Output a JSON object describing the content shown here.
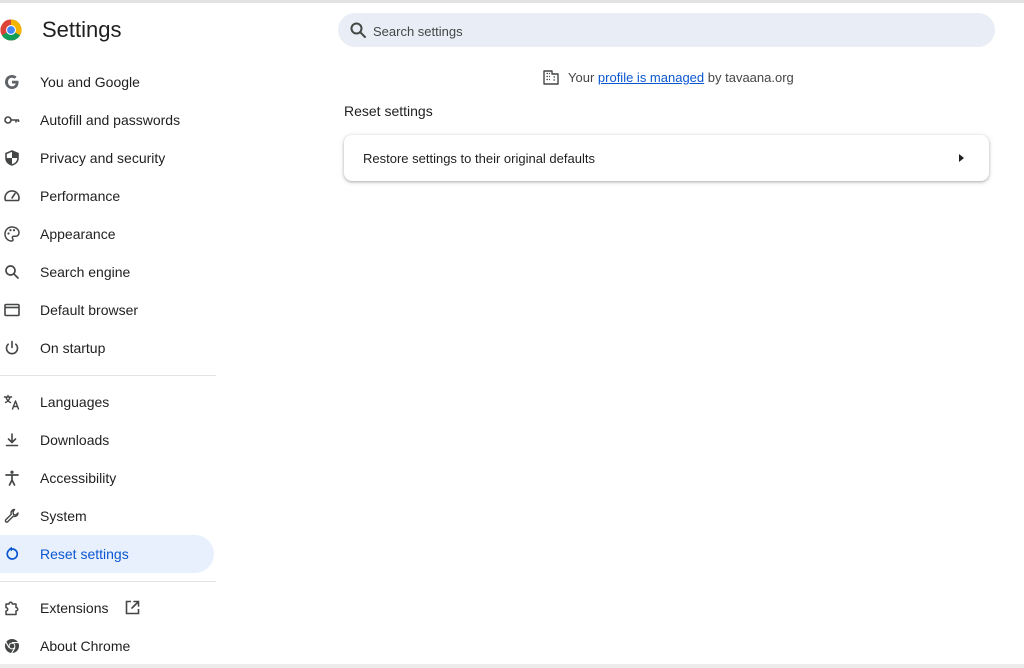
{
  "app": {
    "title": "Settings"
  },
  "search": {
    "placeholder": "Search settings"
  },
  "managed_notice": {
    "prefix": "Your",
    "link": "profile is managed",
    "suffix": "by tavaana.org"
  },
  "sidebar": {
    "items": [
      {
        "label": "You and Google",
        "icon": "google-g-icon"
      },
      {
        "label": "Autofill and passwords",
        "icon": "key-icon"
      },
      {
        "label": "Privacy and security",
        "icon": "shield-icon"
      },
      {
        "label": "Performance",
        "icon": "speedometer-icon"
      },
      {
        "label": "Appearance",
        "icon": "palette-icon"
      },
      {
        "label": "Search engine",
        "icon": "search-icon"
      },
      {
        "label": "Default browser",
        "icon": "browser-window-icon"
      },
      {
        "label": "On startup",
        "icon": "power-icon"
      },
      {
        "label": "Languages",
        "icon": "translate-icon"
      },
      {
        "label": "Downloads",
        "icon": "download-icon"
      },
      {
        "label": "Accessibility",
        "icon": "accessibility-icon"
      },
      {
        "label": "System",
        "icon": "wrench-icon"
      },
      {
        "label": "Reset settings",
        "icon": "reset-icon",
        "active": true
      },
      {
        "label": "Extensions",
        "icon": "puzzle-icon"
      },
      {
        "label": "About Chrome",
        "icon": "chrome-icon"
      }
    ]
  },
  "main": {
    "section_title": "Reset settings",
    "rows": [
      {
        "label": "Restore settings to their original defaults"
      }
    ]
  },
  "colors": {
    "accent": "#0b57d0",
    "active_bg": "#e8f0fe",
    "search_bg": "#e9eef6"
  }
}
